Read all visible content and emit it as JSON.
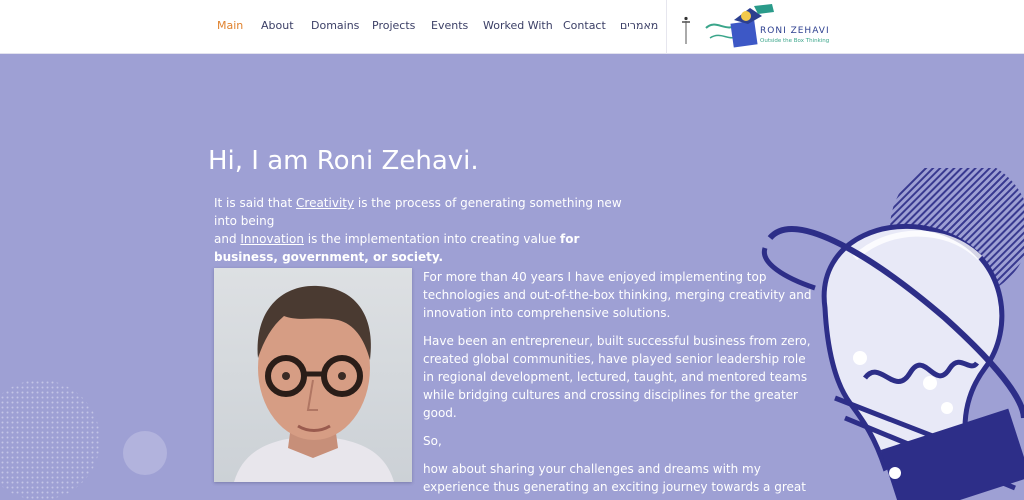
{
  "nav": {
    "items": [
      {
        "label": "Main",
        "active": true
      },
      {
        "label": "About",
        "active": false
      },
      {
        "label": "Domains",
        "active": false
      },
      {
        "label": "Projects",
        "active": false
      },
      {
        "label": "Events",
        "active": false
      },
      {
        "label": "Worked With",
        "active": false
      },
      {
        "label": "Contact",
        "active": false
      },
      {
        "label": "מאמרים",
        "active": false
      }
    ]
  },
  "header": {
    "accessibility_icon": "accessibility-icon",
    "logo": {
      "name": "RONI ZEHAVI",
      "tagline": "Outside the Box Thinking",
      "icon": "lightbulb-box-logo"
    }
  },
  "hero": {
    "title": "Hi, I am Roni Zehavi.",
    "intro": {
      "p1_pre": "It is said that ",
      "p1_link": "Creativity",
      "p1_post": " is the process of generating something new into being",
      "p2_pre": "and ",
      "p2_link": "Innovation",
      "p2_post": " is the implementation into creating value ",
      "p2_bold": "for business, government, or society."
    },
    "paragraphs": [
      "For more than 40 years I have enjoyed implementing top technologies and out-of-the-box thinking, merging creativity and innovation into comprehensive solutions.",
      "Have been an entrepreneur, built successful business from zero, created global communities, have played senior leadership role in regional development, lectured, taught, and mentored teams while bridging cultures and crossing disciplines for the greater good.",
      "So,",
      "how about sharing your challenges and dreams with my experience thus generating an exciting journey towards a great success?"
    ]
  },
  "colors": {
    "background": "#9ea0d4",
    "nav_active": "#e0822d",
    "nav_text": "#3b3f66",
    "accent_dark": "#2f2f8f"
  }
}
